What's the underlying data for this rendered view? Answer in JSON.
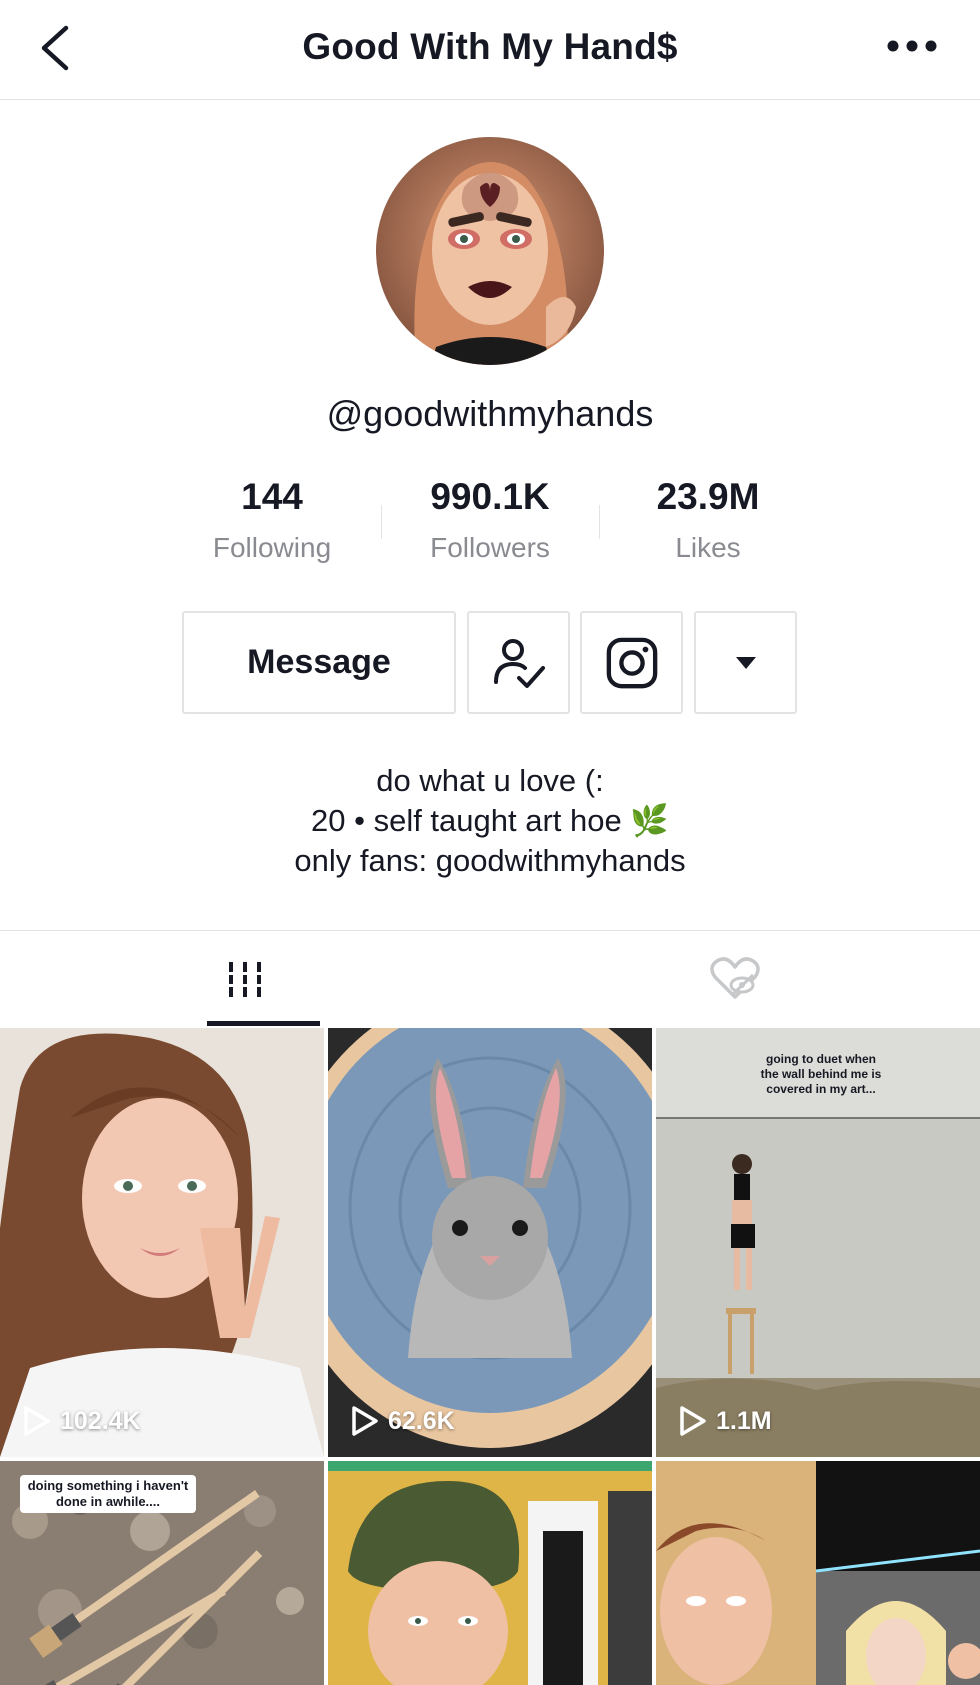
{
  "header": {
    "title": "Good With My Hand$",
    "back_icon": "chevron-left-icon",
    "more_icon": "ellipsis-icon"
  },
  "profile": {
    "handle": "@goodwithmyhands",
    "stats": [
      {
        "value": "144",
        "label": "Following"
      },
      {
        "value": "990.1K",
        "label": "Followers"
      },
      {
        "value": "23.9M",
        "label": "Likes"
      }
    ],
    "buttons": {
      "message_label": "Message",
      "follow_icon": "user-check-icon",
      "instagram_icon": "instagram-icon",
      "dropdown_icon": "caret-down-icon"
    },
    "bio": {
      "line1": "do what u love (:",
      "line2": "20 • self taught art hoe 🌿",
      "line3": "only fans: goodwithmyhands"
    }
  },
  "tabs": [
    {
      "name": "videos",
      "icon": "grid-icon",
      "active": true
    },
    {
      "name": "liked",
      "icon": "hidden-heart-icon",
      "active": false
    }
  ],
  "videos": [
    {
      "views": "102.4K",
      "caption": ""
    },
    {
      "views": "62.6K",
      "caption": ""
    },
    {
      "views": "1.1M",
      "caption": "going to duet when the wall behind me is covered in my art..."
    },
    {
      "views": "",
      "caption": "doing something i haven't done in awhile...."
    },
    {
      "views": "",
      "caption": ""
    },
    {
      "views": "",
      "caption": ""
    }
  ],
  "colors": {
    "text_primary": "#161823",
    "text_secondary": "#8a8b91",
    "divider": "#e3e3e4",
    "background": "#ffffff"
  }
}
